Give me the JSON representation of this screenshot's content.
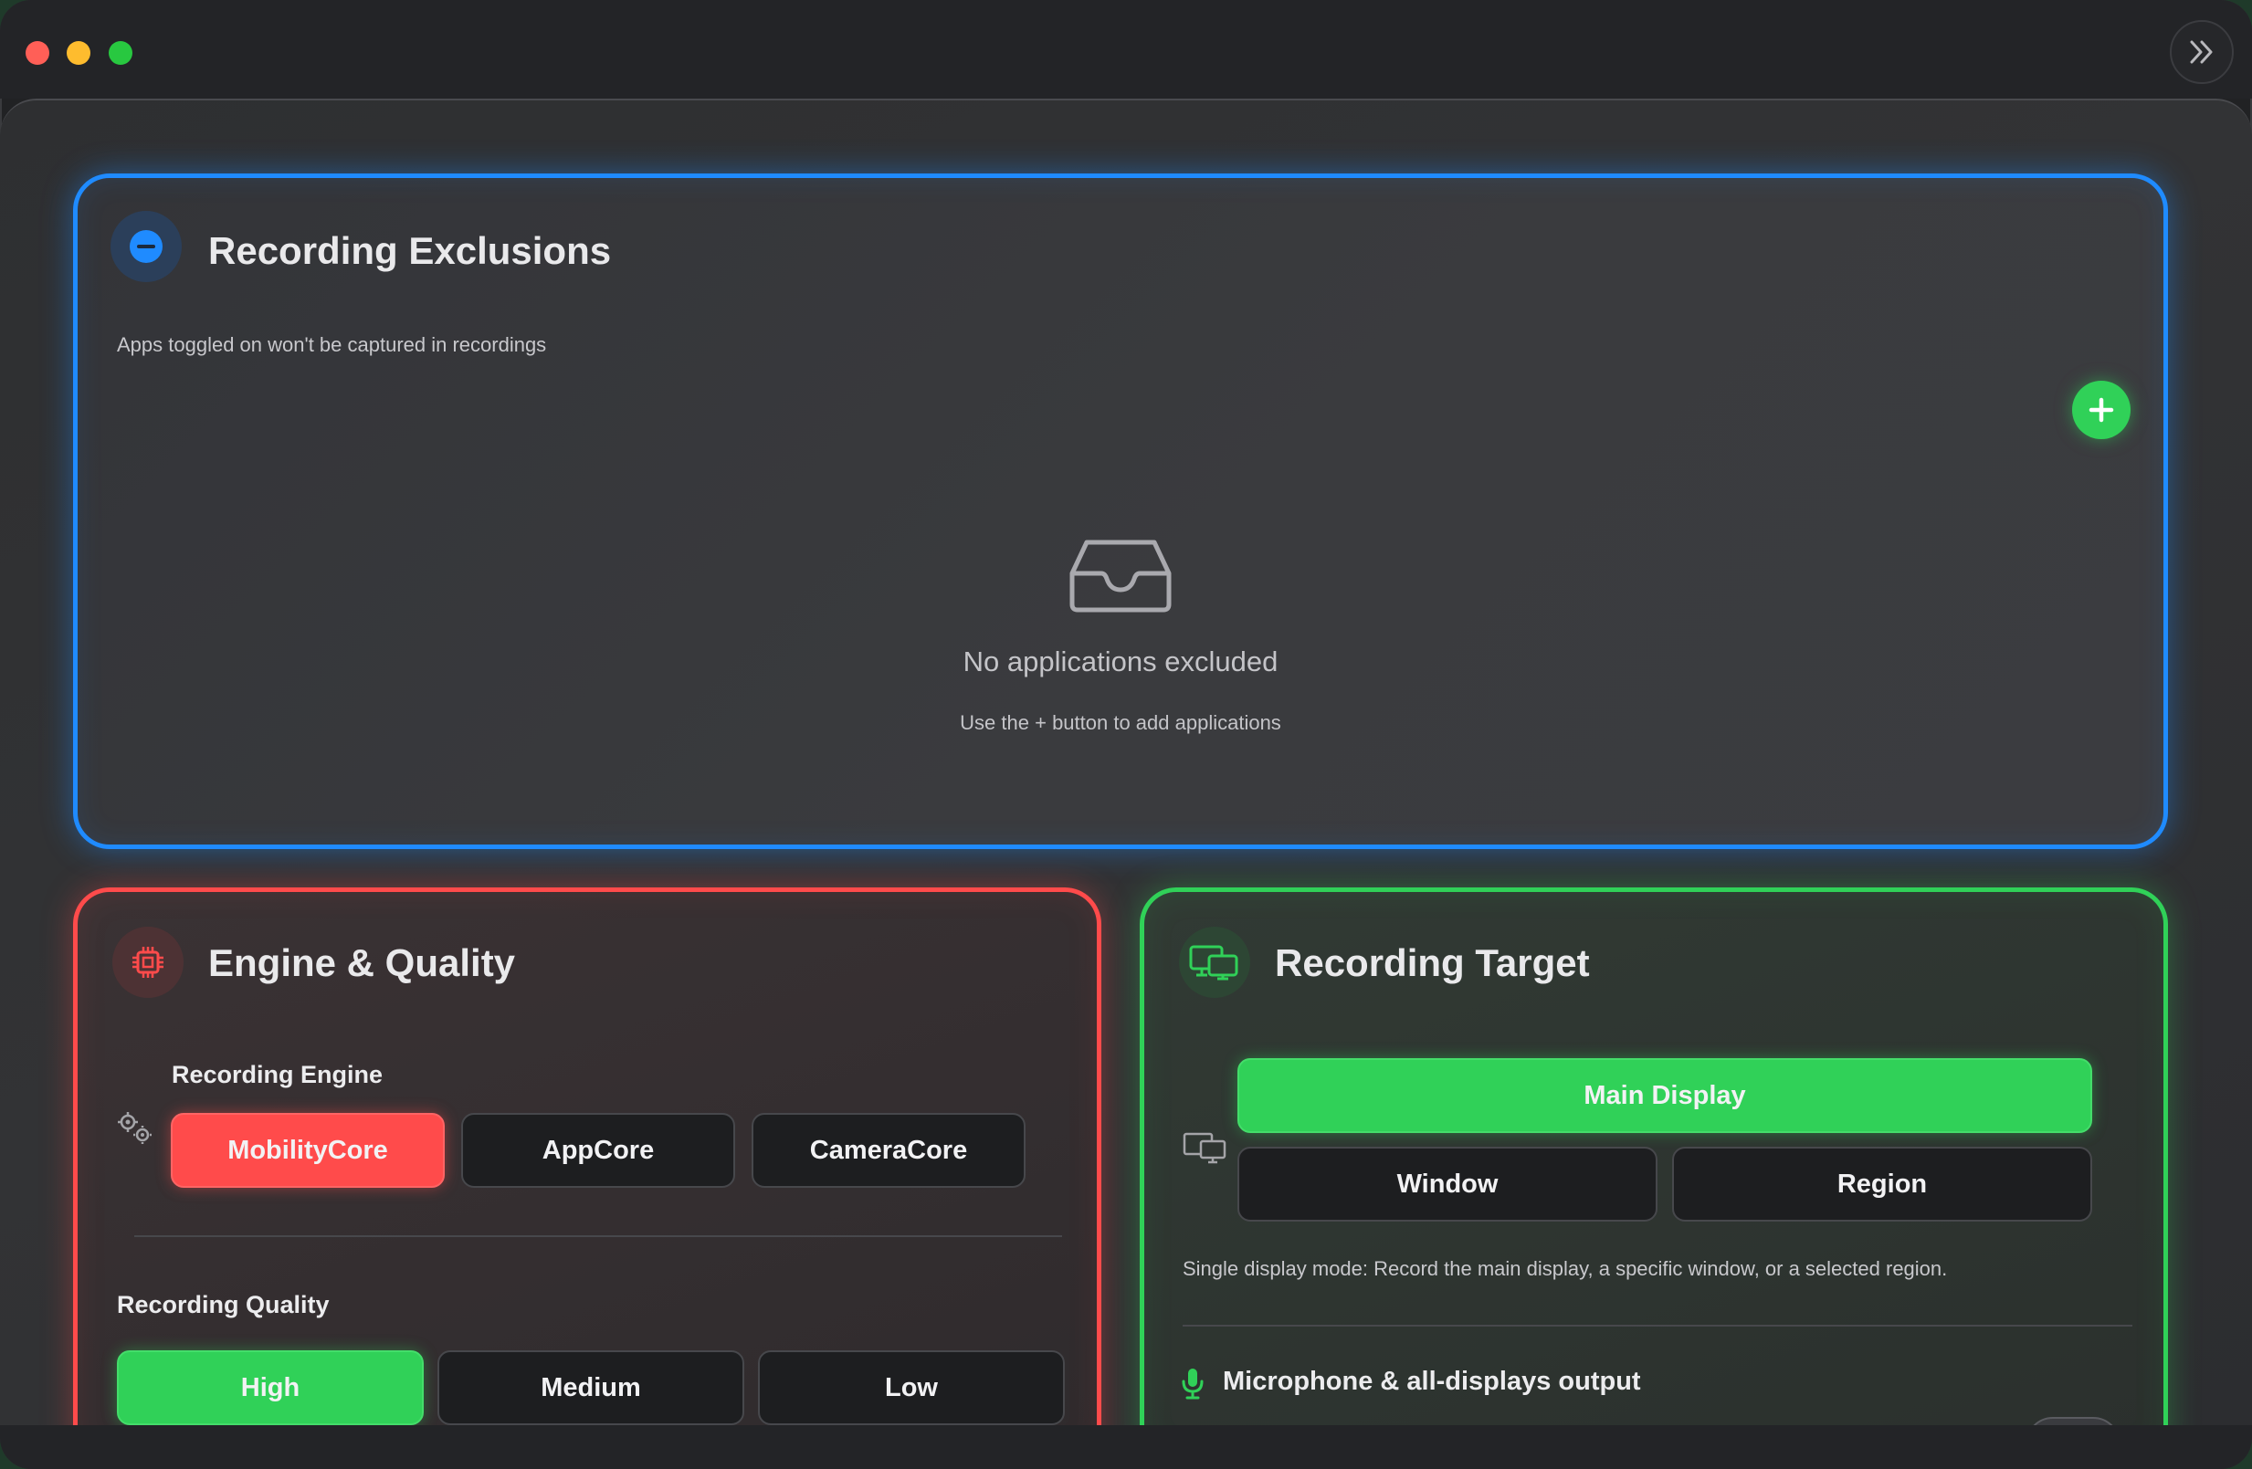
{
  "window": {
    "controls": [
      "close",
      "minimize",
      "maximize"
    ],
    "sidebar_toggle_icon": "chevron-double-right-icon"
  },
  "exclusions": {
    "title": "Recording Exclusions",
    "subtitle": "Apps toggled on won't be captured in recordings",
    "icon": "minus-circle-icon",
    "add_button_icon": "plus-icon",
    "empty_icon": "inbox-tray-icon",
    "empty_title": "No applications excluded",
    "empty_hint": "Use the + button to add applications",
    "accent": "#1f8bff"
  },
  "engine_quality": {
    "title": "Engine & Quality",
    "icon": "cpu-chip-icon",
    "accent": "#ff4b4b",
    "engine_label": "Recording Engine",
    "engine_options": [
      "MobilityCore",
      "AppCore",
      "CameraCore"
    ],
    "engine_selected": "MobilityCore",
    "quality_label": "Recording Quality",
    "quality_options": [
      "High",
      "Medium",
      "Low"
    ],
    "quality_selected": "High"
  },
  "target": {
    "title": "Recording Target",
    "icon": "displays-icon",
    "accent": "#30d158",
    "options": [
      "Main Display",
      "Window",
      "Region"
    ],
    "selected": "Main Display",
    "description": "Single display mode: Record the main display, a specific window, or a selected region.",
    "mic_label": "Microphone & all-displays output",
    "mic_icon": "microphone-icon"
  }
}
